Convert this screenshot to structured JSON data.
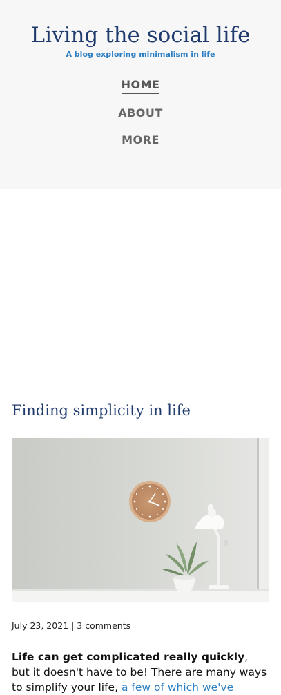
{
  "header": {
    "title": "Living the social life",
    "tagline": "A blog exploring minimalism in life"
  },
  "nav": {
    "items": [
      {
        "label": "HOME"
      },
      {
        "label": "ABOUT"
      },
      {
        "label": "MORE"
      }
    ]
  },
  "post": {
    "title": "Finding simplicity in life",
    "image_alt_icon": "featured-image",
    "date": "July 23, 2021",
    "separator": "|",
    "comments": "3 comments",
    "excerpt_bold": "Life can get complicated really quickly",
    "excerpt_text": ", but it doesn't have to be! There are many ways to simplify your life, ",
    "excerpt_link": "a few of which we've"
  },
  "colors": {
    "title": "#1f3a6d",
    "accent": "#2d7fc4",
    "header_bg": "#f7f7f7"
  }
}
